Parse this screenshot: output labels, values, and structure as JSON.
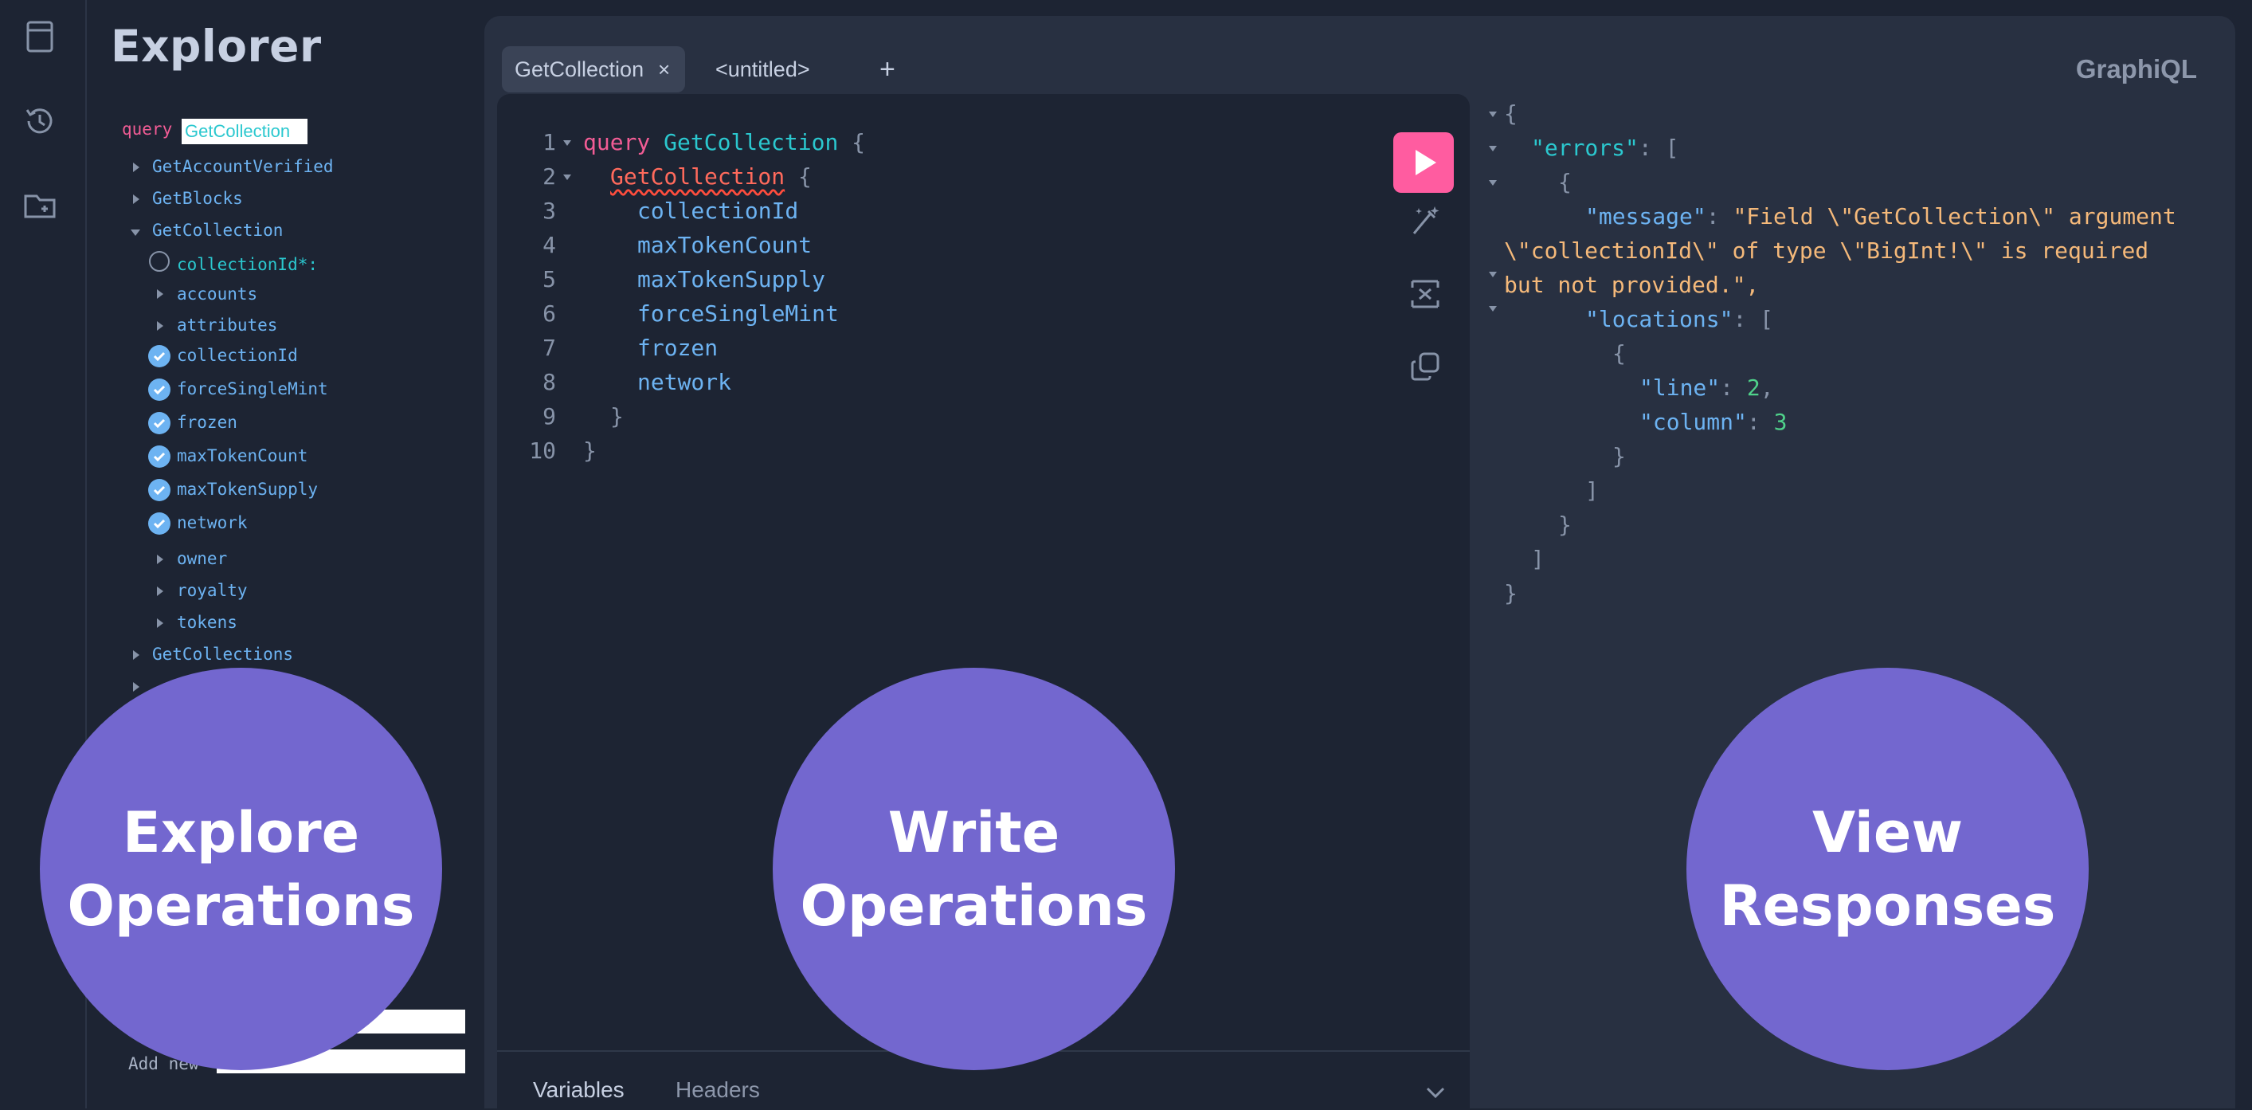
{
  "explorer": {
    "title": "Explorer",
    "query_keyword": "query",
    "operation_name_value": "GetCollection",
    "operations": [
      {
        "label": "GetAccountVerified"
      },
      {
        "label": "GetBlocks"
      },
      {
        "label": "GetCollection"
      },
      {
        "label": "GetCollections"
      }
    ],
    "fields": [
      {
        "label": "collectionId*:",
        "kind": "argument"
      },
      {
        "label": "accounts",
        "kind": "expandable"
      },
      {
        "label": "attributes",
        "kind": "expandable"
      },
      {
        "label": "collectionId",
        "kind": "checked"
      },
      {
        "label": "forceSingleMint",
        "kind": "checked"
      },
      {
        "label": "frozen",
        "kind": "checked"
      },
      {
        "label": "maxTokenCount",
        "kind": "checked"
      },
      {
        "label": "maxTokenSupply",
        "kind": "checked"
      },
      {
        "label": "network",
        "kind": "checked"
      },
      {
        "label": "owner",
        "kind": "expandable"
      },
      {
        "label": "royalty",
        "kind": "expandable"
      },
      {
        "label": "tokens",
        "kind": "expandable"
      }
    ],
    "add_new_label": "Add new"
  },
  "tabs": [
    {
      "label": "GetCollection",
      "close": "×"
    },
    {
      "label": "<untitled>"
    }
  ],
  "add_tab": "+",
  "brand": "GraphiQL",
  "editor": {
    "line_numbers": [
      "1",
      "2",
      "3",
      "4",
      "5",
      "6",
      "7",
      "8",
      "9",
      "10"
    ],
    "lines": {
      "l1_kw": "query",
      "l1_name": "GetCollection",
      "l1_brace": "{",
      "l2_field": "GetCollection",
      "l2_brace": "{",
      "l3": "collectionId",
      "l4": "maxTokenCount",
      "l5": "maxTokenSupply",
      "l6": "forceSingleMint",
      "l7": "frozen",
      "l8": "network",
      "l9": "}",
      "l10": "}"
    },
    "bottom_tabs": [
      "Variables",
      "Headers"
    ]
  },
  "response": {
    "open_brace": "{",
    "errors_key": "\"errors\"",
    "colon_bracket": ": [",
    "obj_open": "{",
    "message_key": "\"message\"",
    "message_value_1": "\"Field \\\"GetCollection\\\" argument",
    "message_value_2": "\\\"collectionId\\\" of type \\\"BigInt!\\\" is required",
    "message_value_3": "but not provided.\",",
    "locations_key": "\"locations\"",
    "loc_open": "{",
    "line_key": "\"line\"",
    "line_value": "2",
    "column_key": "\"column\"",
    "column_value": "3",
    "loc_close": "}",
    "arr_close": "]",
    "obj_close": "}",
    "errors_close": "]",
    "close_brace": "}"
  },
  "overlays": {
    "explore": [
      "Explore",
      "Operations"
    ],
    "write": [
      "Write",
      "Operations"
    ],
    "view": [
      "View",
      "Responses"
    ]
  },
  "colors": {
    "accent_run": "#ff5ca0",
    "overlay": "#7367cf",
    "keyword": "#f25c95",
    "field": "#6db3f2",
    "string": "#f5b97a",
    "number": "#4fd18a"
  }
}
